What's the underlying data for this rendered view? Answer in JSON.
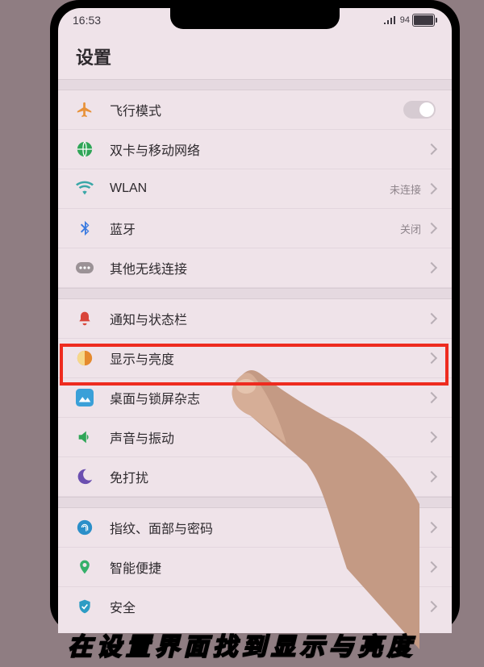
{
  "status": {
    "time": "16:53",
    "battery": "94"
  },
  "title": "设置",
  "rows": {
    "airplane": {
      "label": "飞行模式"
    },
    "sim": {
      "label": "双卡与移动网络"
    },
    "wlan": {
      "label": "WLAN",
      "value": "未连接"
    },
    "bt": {
      "label": "蓝牙",
      "value": "关闭"
    },
    "other": {
      "label": "其他无线连接"
    },
    "notify": {
      "label": "通知与状态栏"
    },
    "display": {
      "label": "显示与亮度"
    },
    "home": {
      "label": "桌面与锁屏杂志"
    },
    "sound": {
      "label": "声音与振动"
    },
    "dnd": {
      "label": "免打扰"
    },
    "biometric": {
      "label": "指纹、面部与密码"
    },
    "smart": {
      "label": "智能便捷"
    },
    "security": {
      "label": "安全"
    }
  },
  "caption": "在设置界面找到显示与亮度"
}
